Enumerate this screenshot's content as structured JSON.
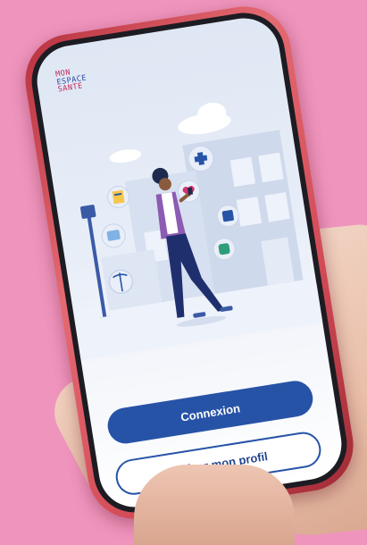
{
  "app": {
    "logo_lines": [
      "MON",
      "ESPACE",
      "SANTE"
    ]
  },
  "buttons": {
    "connexion": "Connexion",
    "activer_profil": "Activer mon profil"
  },
  "colors": {
    "background": "#ef94bd",
    "primary": "#2753a7",
    "logo_pink": "#c0285b",
    "phone_case": "#d24b57"
  },
  "illustration_icons": [
    "plus-icon",
    "heart-icon",
    "document-icon",
    "medication-icon",
    "id-card-icon",
    "medical-device-icon",
    "caduceus-icon"
  ]
}
